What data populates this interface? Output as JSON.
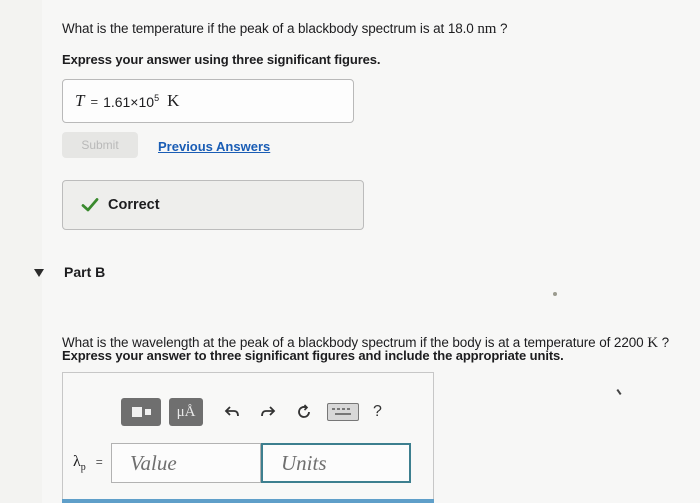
{
  "part_a": {
    "question_prefix": "What is the temperature if the peak of a blackbody spectrum is at 18.0",
    "question_unit": "nm",
    "question_suffix": "?",
    "instruction": "Express your answer using three significant figures.",
    "answer": {
      "variable": "T",
      "equals": "=",
      "mantissa": "1.61×10",
      "exponent": "5",
      "unit": "K"
    },
    "submit_label": "Submit",
    "previous_answers_label": "Previous Answers",
    "feedback": "Correct"
  },
  "part_b": {
    "label": "Part B",
    "question_prefix": "What is the wavelength at the peak of a blackbody spectrum if the body is at a temperature of 2200",
    "question_unit": "K",
    "question_suffix": "?",
    "instruction": "Express your answer to three significant figures and include the appropriate units.",
    "toolbar": {
      "units_label": "μÅ",
      "help_label": "?"
    },
    "variable": "λ",
    "variable_sub": "p",
    "equals": "=",
    "value_placeholder": "Value",
    "units_placeholder": "Units"
  },
  "colors": {
    "link": "#1a5db5",
    "correct_check": "#3a8a2e",
    "units_field_border": "#3d7f8f"
  }
}
